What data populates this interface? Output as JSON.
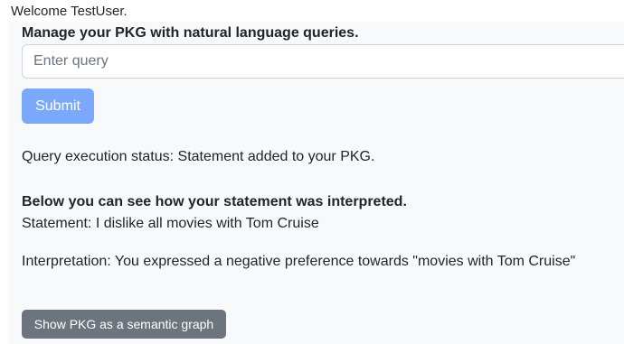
{
  "welcome_text": "Welcome TestUser.",
  "main": {
    "heading": "Manage your PKG with natural language queries.",
    "query": {
      "placeholder": "Enter query",
      "value": ""
    },
    "submit_label": "Submit",
    "status_text": "Query execution status: Statement added to your PKG.",
    "interpretation_heading": "Below you can see how your statement was interpreted.",
    "statement_text": "Statement: I dislike all movies with Tom Cruise",
    "interpretation_text": "Interpretation: You expressed a negative preference towards \"movies with Tom Cruise\"",
    "graph_button_label": "Show PKG as a semantic graph"
  },
  "colors": {
    "submit_button": "#7aa9fb",
    "secondary_button": "#6c757d",
    "panel_background": "#f8f9fa",
    "text": "#212529"
  }
}
